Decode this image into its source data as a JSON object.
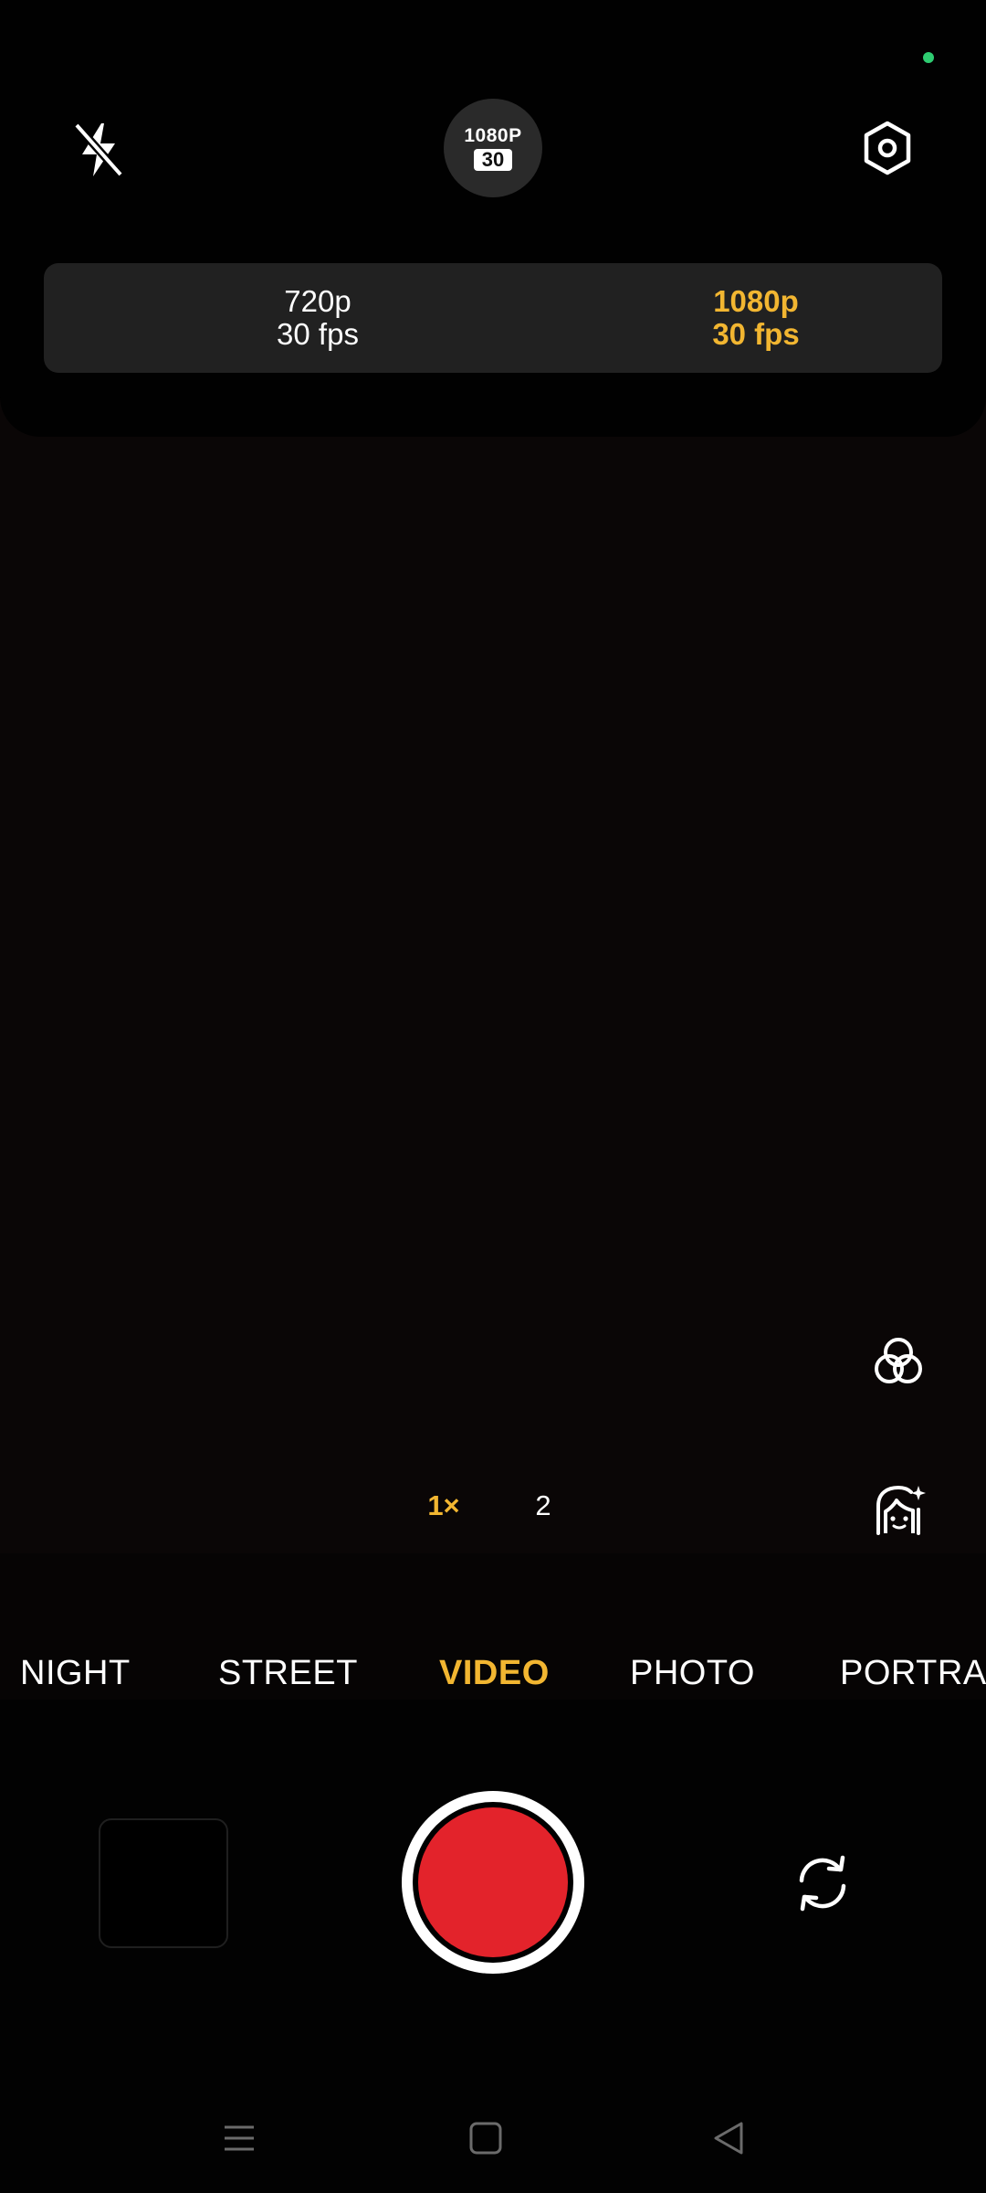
{
  "top_bar": {
    "flash_icon": "flash-off-icon",
    "settings_icon": "hexagon-settings-icon",
    "resolution_badge": {
      "top": "1080P",
      "fps": "30"
    }
  },
  "resolution_options": [
    {
      "res": "720p",
      "fps": "30 fps",
      "selected": false
    },
    {
      "res": "1080p",
      "fps": "30 fps",
      "selected": true
    }
  ],
  "side_tools": {
    "filter_icon": "filter-circles-icon",
    "beauty_icon": "face-beauty-icon"
  },
  "zoom": {
    "current": "1×",
    "option": "2"
  },
  "modes": [
    {
      "label": "NIGHT",
      "active": false
    },
    {
      "label": "STREET",
      "active": false
    },
    {
      "label": "VIDEO",
      "active": true
    },
    {
      "label": "PHOTO",
      "active": false
    },
    {
      "label": "PORTRAIT",
      "active": false
    }
  ],
  "bottom_controls": {
    "thumbnail": "gallery-thumbnail",
    "shutter": "record-button",
    "switch_icon": "switch-camera-icon"
  },
  "colors": {
    "accent": "#f2b631",
    "record": "#e3232b",
    "status_dot": "#2ecc71"
  },
  "navigation": {
    "menu_icon": "menu-icon",
    "home_icon": "home-icon",
    "back_icon": "back-icon"
  }
}
